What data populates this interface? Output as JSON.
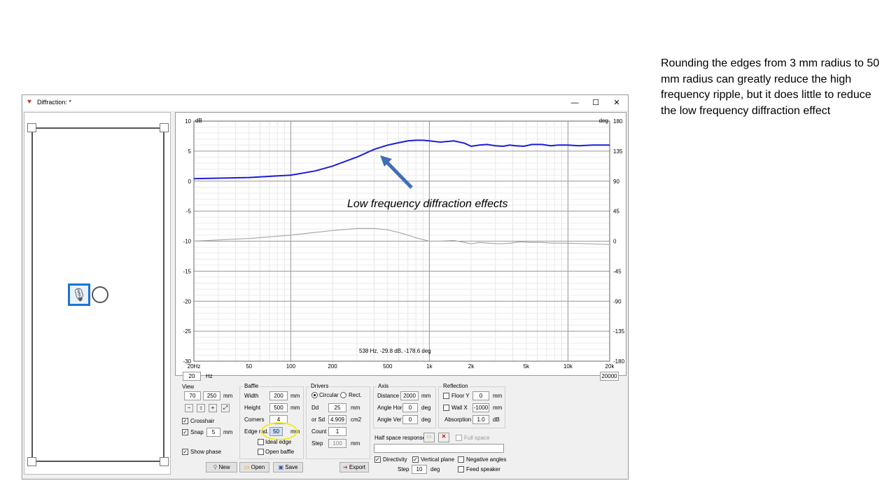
{
  "slide": {
    "note": "Rounding the edges from 3 mm radius to 50 mm radius can greatly reduce the high frequency ripple, but it does little to reduce the low frequency diffraction effect"
  },
  "window": {
    "title": "Diffraction: *",
    "minimize": "—",
    "maximize": "☐",
    "close": "✕"
  },
  "chart_data": {
    "type": "line",
    "x_scale": "log",
    "x_range": [
      20,
      20000
    ],
    "y_left_range": [
      -30,
      10
    ],
    "y_right_range": [
      -180,
      180
    ],
    "y_left_unit": "dB",
    "y_right_unit": "deg",
    "y_left_ticks": [
      "10",
      "5",
      "0",
      "-5",
      "-10",
      "-15",
      "-20",
      "-25",
      "-30"
    ],
    "y_right_ticks": [
      "180",
      "135",
      "90",
      "45",
      "0",
      "-45",
      "-90",
      "-135",
      "-180"
    ],
    "x_ticks": [
      "20Hz",
      "50",
      "100",
      "200",
      "500",
      "1k",
      "2k",
      "5k",
      "10k",
      "20k"
    ],
    "x_tick_values": [
      20,
      50,
      100,
      200,
      500,
      1000,
      2000,
      5000,
      10000,
      20000
    ],
    "grid": true,
    "series": [
      {
        "color": "#1c1cd8",
        "x": [
          20,
          50,
          100,
          150,
          200,
          300,
          400,
          500,
          600,
          700,
          800,
          900,
          1000,
          1200,
          1500,
          1800,
          2000,
          2300,
          2600,
          3000,
          3400,
          3800,
          4200,
          4800,
          5500,
          6500,
          7500,
          8500,
          10000,
          12000,
          15000,
          20000
        ],
        "y": [
          0.4,
          0.6,
          1.0,
          1.7,
          2.5,
          4.0,
          5.3,
          6.0,
          6.4,
          6.7,
          6.8,
          6.8,
          6.7,
          6.5,
          6.7,
          6.3,
          5.8,
          6.0,
          6.1,
          5.9,
          5.8,
          6.0,
          5.9,
          5.8,
          6.1,
          6.1,
          5.9,
          6.0,
          6.0,
          5.9,
          6.0,
          6.0
        ]
      },
      {
        "color": "#a8a8a8",
        "axis": "right",
        "x": [
          20,
          50,
          100,
          200,
          300,
          400,
          500,
          600,
          700,
          800,
          1000,
          1200,
          1500,
          1800,
          2000,
          2300,
          2700,
          3200,
          3800,
          4500,
          5500,
          6500,
          8000,
          10000,
          14000,
          20000
        ],
        "y": [
          0,
          4,
          9,
          16,
          19,
          19,
          17,
          13,
          9,
          5,
          0,
          0,
          1,
          -2,
          -4,
          -2,
          -3,
          -4,
          -3,
          -1,
          -2,
          -2,
          -3,
          -3,
          -4,
          -5
        ]
      }
    ],
    "annotation": "Low frequency diffraction effects",
    "cursor_readout": "538 Hz, -29.8 dB, -178.6 deg"
  },
  "range": {
    "min": "20",
    "unit": "Hz",
    "max": "20000"
  },
  "view": {
    "title": "View",
    "from": "70",
    "to": "250",
    "unit": "mm",
    "crosshair": "Crosshair",
    "snap": "Snap",
    "snap_value": "5",
    "snap_unit": "mm",
    "show_phase": "Show phase"
  },
  "baffle": {
    "title": "Baffle",
    "width_label": "Width",
    "width": "200",
    "height_label": "Height",
    "height": "500",
    "unit": "mm",
    "corners_label": "Corners",
    "corners": "4",
    "edge_label": "Edge rad.",
    "edge": "50",
    "edge_unit": "mm",
    "ideal_edge": "Ideal edge",
    "open_baffle": "Open baffle"
  },
  "drivers": {
    "title": "Drivers",
    "circular": "Circular",
    "rect": "Rect.",
    "dd_label": "Dd",
    "dd": "25",
    "dd_unit": "mm",
    "sd_label": "or Sd",
    "sd": "4.909",
    "sd_unit": "cm2",
    "count_label": "Count",
    "count": "1",
    "step_label": "Step",
    "step": "100",
    "step_unit": "mm"
  },
  "axis": {
    "title": "Axis",
    "distance_label": "Distance",
    "distance": "2000",
    "unit": "mm",
    "hor_label": "Angle Hor",
    "hor": "0",
    "ver_label": "Angle Ver",
    "ver": "0",
    "deg": "deg"
  },
  "reflection": {
    "title": "Reflection",
    "floor_label": "Floor Y",
    "floor": "0",
    "wall_label": "Wall  X",
    "wall": "-1000",
    "unit": "mm",
    "absorption_label": "Absorption",
    "absorption": "1.0",
    "db": "dB"
  },
  "half_space": {
    "label": "Half space response",
    "full_space": "Full space"
  },
  "directivity": {
    "directivity": "Directivity",
    "vertical_plane": "Vertical plane",
    "negative_angles": "Negative angles",
    "step_label": "Step",
    "step": "10",
    "deg": "deg",
    "feed_speaker": "Feed speaker"
  },
  "buttons": {
    "new": "New",
    "open": "Open",
    "save": "Save",
    "export": "Export"
  }
}
